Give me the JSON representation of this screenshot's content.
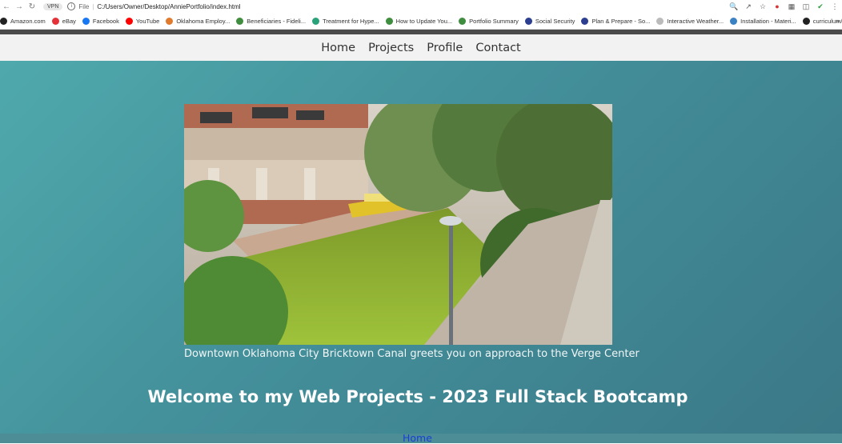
{
  "browser": {
    "vpn_label": "VPN",
    "scheme": "File",
    "url": "C:/Users/Owner/Desktop/AnniePortfolio/index.html",
    "bookmarks": [
      {
        "label": "Amazon.com",
        "icon": "amazon-icon",
        "color": "#222222"
      },
      {
        "label": "eBay",
        "icon": "ebay-icon",
        "color": "#e53238"
      },
      {
        "label": "Facebook",
        "icon": "facebook-icon",
        "color": "#1877f2"
      },
      {
        "label": "YouTube",
        "icon": "youtube-icon",
        "color": "#ff0000"
      },
      {
        "label": "Oklahoma Employ...",
        "icon": "gear-icon",
        "color": "#e07a2d"
      },
      {
        "label": "Beneficiaries - Fideli...",
        "icon": "fidelity-icon",
        "color": "#3f8e3f"
      },
      {
        "label": "Treatment for Hype...",
        "icon": "health-icon",
        "color": "#2aa37a"
      },
      {
        "label": "How to Update You...",
        "icon": "fidelity-icon",
        "color": "#3f8e3f"
      },
      {
        "label": "Portfolio Summary",
        "icon": "fidelity-icon",
        "color": "#3f8e3f"
      },
      {
        "label": "Social Security",
        "icon": "ssa-icon",
        "color": "#2c3e8f"
      },
      {
        "label": "Plan & Prepare - So...",
        "icon": "ssa-icon",
        "color": "#2c3e8f"
      },
      {
        "label": "Interactive Weather...",
        "icon": "page-icon",
        "color": "#bbbbbb"
      },
      {
        "label": "Installation - Materi...",
        "icon": "material-icon",
        "color": "#3b82c4"
      },
      {
        "label": "curriculum/Additio...",
        "icon": "github-icon",
        "color": "#222222"
      }
    ],
    "more_label": "»"
  },
  "site": {
    "nav": [
      "Home",
      "Projects",
      "Profile",
      "Contact"
    ],
    "caption": "Downtown Oklahoma City Bricktown Canal greets you on approach to the Verge Center",
    "welcome": "Welcome to my Web Projects - 2023 Full Stack Bootcamp",
    "bottom_link": "Home",
    "colors": {
      "accent_link": "#1a3fd6",
      "bg_gradient_start": "#4fa9ac",
      "bg_gradient_end": "#3b7887"
    }
  }
}
